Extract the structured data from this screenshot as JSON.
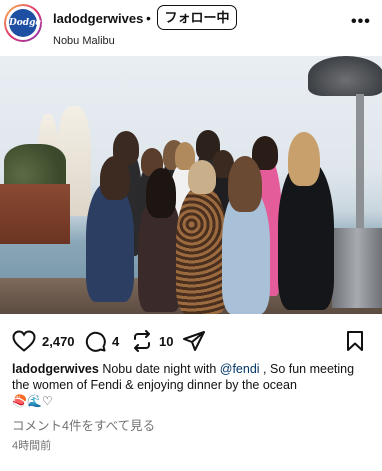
{
  "post": {
    "username": "ladodgerwives",
    "separator": "•",
    "follow_label": "フォロー中",
    "location": "Nobu Malibu",
    "more_label": "•••",
    "avatar_text": "Dodgers"
  },
  "actions": {
    "like_count": "2,470",
    "comment_count": "4",
    "repost_count": "10"
  },
  "caption": {
    "username": "ladodgerwives",
    "text_before": " Nobu date night with ",
    "mention": "@fendi",
    "text_after": " , So fun meeting the women of Fendi & enjoying dinner by the ocean",
    "emojis": "🍣🌊♡"
  },
  "comments_link": "コメント4件をすべて見る",
  "timestamp": "4時間前",
  "colors": {
    "mention": "#00376b",
    "muted": "#737373",
    "avatar_blue": "#1e4fa3"
  }
}
